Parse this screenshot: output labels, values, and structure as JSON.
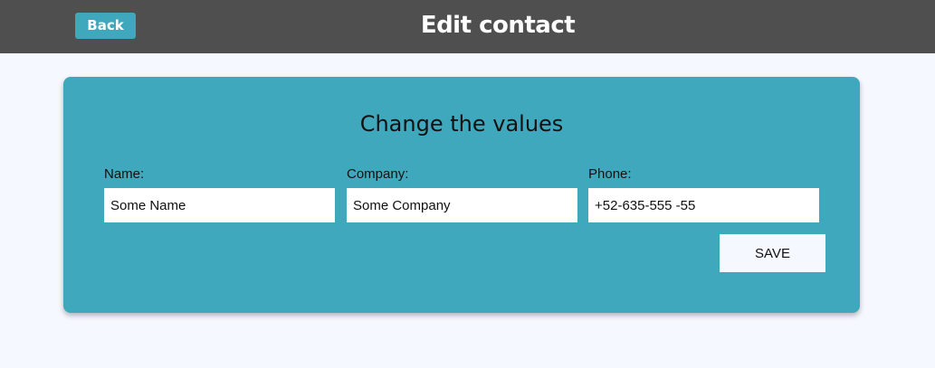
{
  "header": {
    "back_label": "Back",
    "title": "Edit contact"
  },
  "form": {
    "heading": "Change the values",
    "fields": [
      {
        "label": "Name:",
        "value": "Some Name"
      },
      {
        "label": "Company:",
        "value": "Some Company"
      },
      {
        "label": "Phone:",
        "value": "+52-635-555 -55"
      }
    ],
    "save_label": "SAVE"
  },
  "colors": {
    "header_bg": "#4f4f4f",
    "accent": "#3fa8bd",
    "page_bg": "#f5f8fe"
  }
}
